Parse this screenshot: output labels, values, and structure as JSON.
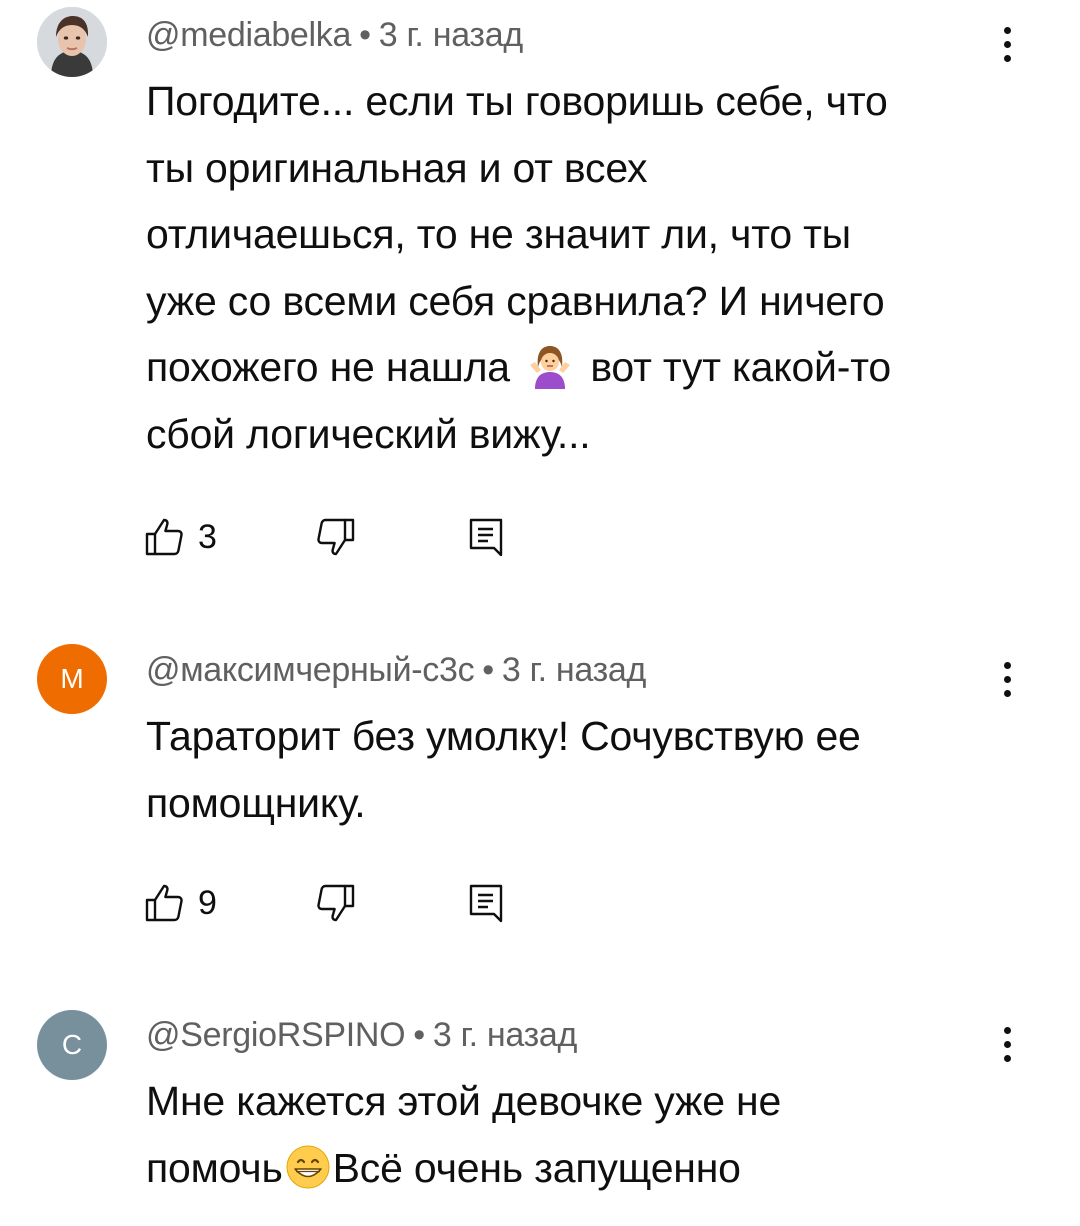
{
  "comments": [
    {
      "author": "@mediabelka",
      "time": "3 г. назад",
      "avatar_color": "#cfd3d6",
      "text_lines": [
        "Погодите... если ты говоришь себе, что",
        "ты оригинальная и от всех",
        "отличаешься, то не значит ли, что ты",
        "уже со всеми себя сравнила? И ничего"
      ],
      "text_line5_before": "похожего не нашла",
      "text_line5_after": "вот тут какой-то",
      "text_line6": "сбой логический вижу...",
      "emoji": "woman-shrugging-emoji",
      "likes": "3"
    },
    {
      "author": "@максимчерный-с3с",
      "time": "3 г. назад",
      "avatar_letter": "М",
      "avatar_color": "#ef6c00",
      "text_lines": [
        "Тараторит без умолку! Сочувствую ее",
        "помощнику."
      ],
      "likes": "9"
    },
    {
      "author": "@SergioRSPINO",
      "time": "3 г. назад",
      "avatar_letter": "С",
      "avatar_color": "#78909c",
      "text_line1": "Мне кажется этой девочке уже не",
      "text_line2_before": "помочь",
      "text_line2_after": "Всё очень запущенно",
      "emoji": "grinning-face-emoji"
    }
  ],
  "separator": "•",
  "icons": {
    "like": "thumb-up-icon",
    "dislike": "thumb-down-icon",
    "reply": "reply-comment-icon",
    "menu": "more-vert-icon"
  }
}
